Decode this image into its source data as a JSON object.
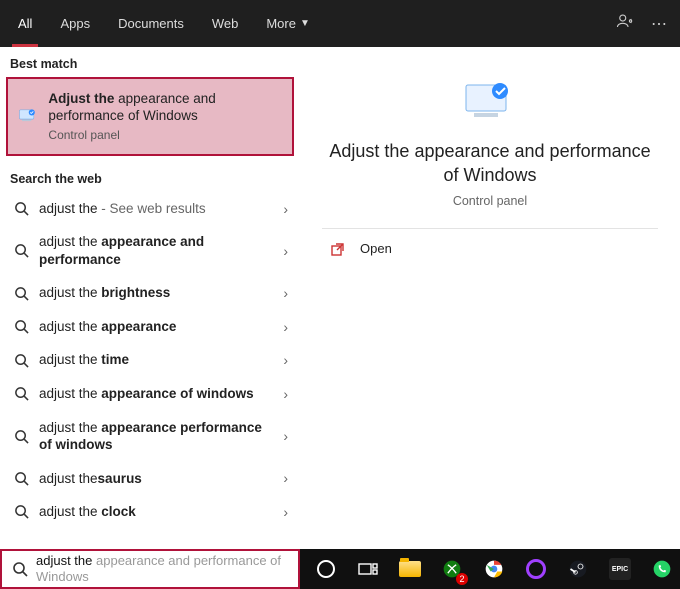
{
  "tabs": {
    "items": [
      "All",
      "Apps",
      "Documents",
      "Web",
      "More"
    ],
    "active_index": 0
  },
  "sections": {
    "best_match": "Best match",
    "search_web": "Search the web"
  },
  "best_match": {
    "title_pre_bold": "Adjust the",
    "title_rest": " appearance and performance of Windows",
    "subtitle": "Control panel"
  },
  "web_results": [
    {
      "prefix": "adjust the",
      "bold": "",
      "suffix": " - See web results",
      "suffix_light": true
    },
    {
      "prefix": "adjust the ",
      "bold": "appearance and performance",
      "suffix": ""
    },
    {
      "prefix": "adjust the ",
      "bold": "brightness",
      "suffix": ""
    },
    {
      "prefix": "adjust the ",
      "bold": "appearance",
      "suffix": ""
    },
    {
      "prefix": "adjust the ",
      "bold": "time",
      "suffix": ""
    },
    {
      "prefix": "adjust the ",
      "bold": "appearance of windows",
      "suffix": ""
    },
    {
      "prefix": "adjust the ",
      "bold": "appearance performance of windows",
      "suffix": ""
    },
    {
      "prefix": "adjust the",
      "bold": "saurus",
      "suffix": ""
    },
    {
      "prefix": "adjust the ",
      "bold": "clock",
      "suffix": ""
    }
  ],
  "preview": {
    "title": "Adjust the appearance and performance of Windows",
    "subtitle": "Control panel",
    "open_label": "Open"
  },
  "search": {
    "typed": "adjust the ",
    "ghost": "appearance and performance of Windows"
  },
  "taskbar": {
    "xbox_badge": "2",
    "epic_label": "EPIC"
  }
}
